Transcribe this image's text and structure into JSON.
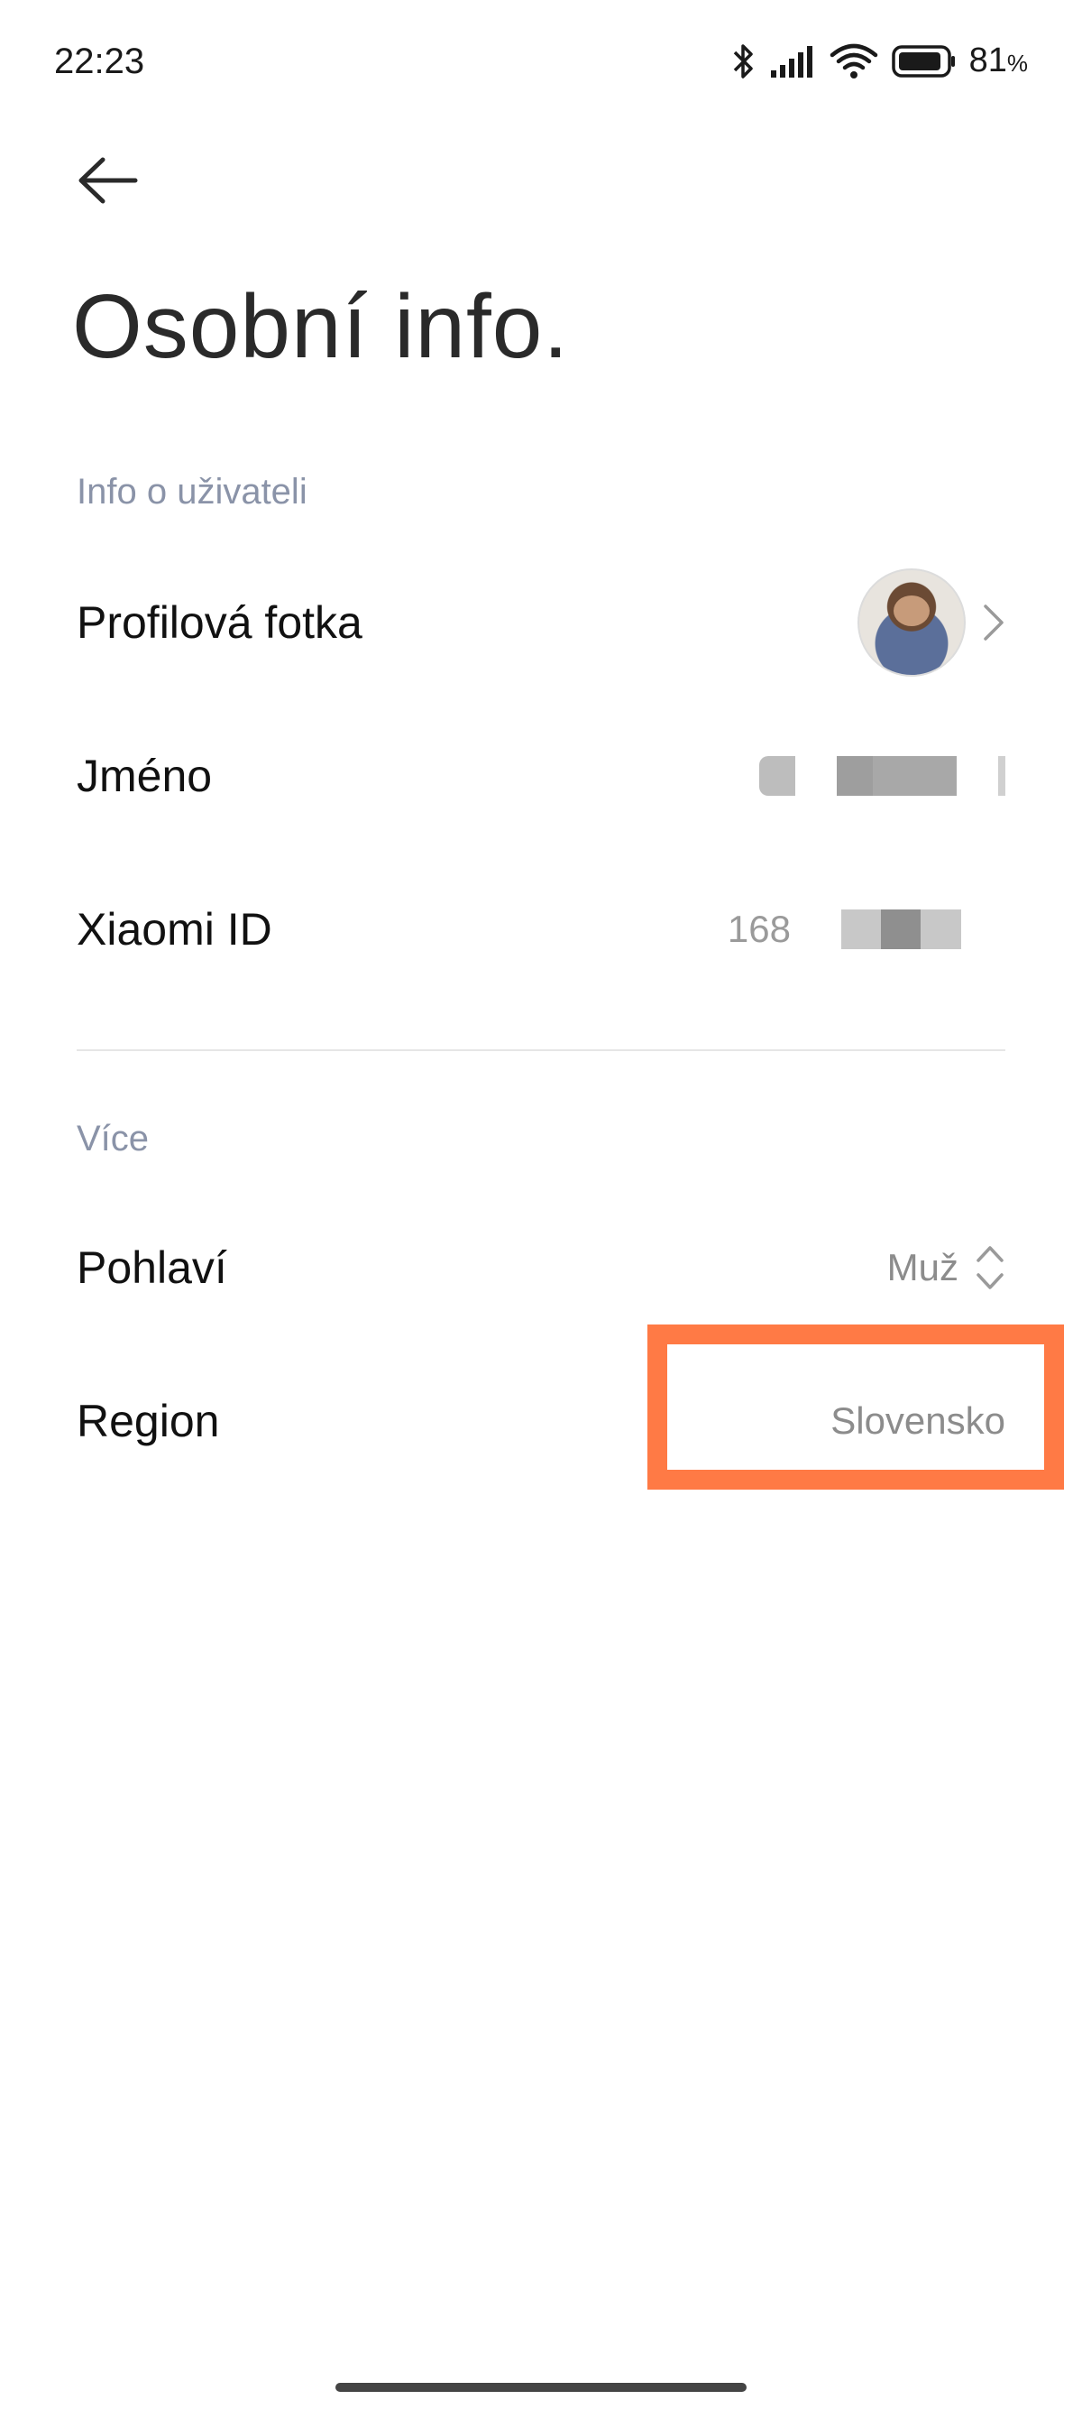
{
  "status_bar": {
    "time": "22:23",
    "battery_percent": "81",
    "battery_unit": "%",
    "icons": [
      "bluetooth-icon",
      "signal-icon",
      "wifi-icon",
      "battery-icon"
    ]
  },
  "header": {
    "back_icon": "arrow-left-icon",
    "title": "Osobní info."
  },
  "sections": {
    "user_info": {
      "label": "Info o uživateli",
      "rows": {
        "profile_photo": {
          "label": "Profilová fotka"
        },
        "name": {
          "label": "Jméno"
        },
        "xiaomi_id": {
          "label": "Xiaomi ID",
          "value_prefix": "168"
        }
      }
    },
    "more": {
      "label": "Více",
      "rows": {
        "gender": {
          "label": "Pohlaví",
          "value": "Muž"
        },
        "region": {
          "label": "Region",
          "value": "Slovensko"
        }
      }
    }
  },
  "colors": {
    "highlight": "#ff7a45",
    "section_label": "#8a93a8",
    "value_text": "#8c8c8c"
  }
}
